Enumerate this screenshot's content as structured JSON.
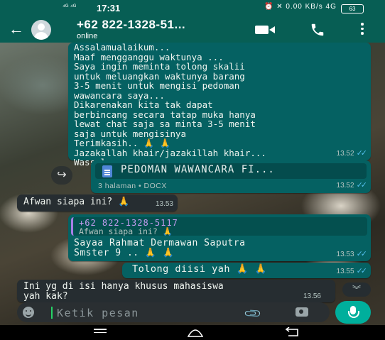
{
  "status_bar": {
    "signal": "⁴ᴳ ⁴ᴳ",
    "time": "17:31",
    "right_indicators": "⏰ ✕ 0.00 KB/s 4G",
    "battery": "63"
  },
  "header": {
    "back": "←",
    "contact_name": "+62 822-1328-51...",
    "status": "online"
  },
  "messages": [
    {
      "direction": "out",
      "text": "Assalamualaikum...\nMaaf mengganggu waktunya ...\nSaya ingin meminta tolong skalii\nuntuk meluangkan waktunya barang\n3-5 menit untuk mengisi pedoman\nwawancara saya...\nDikarenakan kita tak dapat\nberbincang secara tatap muka hanya\nlewat chat saja sa minta 3-5 menit\nsaja untuk mengisinya\nTerimkasih.. 🙏 🙏\nJazakallah khair/jazakillah khair...\nWassalam",
      "time": "13.52",
      "ticks": "✓✓"
    },
    {
      "direction": "out",
      "type": "document",
      "file_name": "PEDOMAN WAWANCARA FI...",
      "file_meta": "3 halaman • DOCX",
      "time": "13.52",
      "ticks": "✓✓"
    },
    {
      "direction": "in",
      "text": "Afwan siapa ini? 🙏",
      "time": "13.53"
    },
    {
      "direction": "out",
      "quote_name": "+62 822-1328-5117",
      "quote_text": "Afwan siapa ini? 🙏",
      "text": "Sayaa Rahmat Dermawan Saputra\nSmster 9 .. 🙏 🙏",
      "time": "13.53",
      "ticks": "✓✓"
    },
    {
      "direction": "out",
      "text": "Tolong diisi yah 🙏 🙏",
      "time": "13.55",
      "ticks": "✓✓"
    },
    {
      "direction": "in",
      "text": "Ini yg di isi hanya khusus mahasiswa\nyah kak?",
      "time": "13.56"
    }
  ],
  "input_bar": {
    "placeholder": "Ketik pesan"
  },
  "icons": {
    "forward": "↪",
    "scroll_down": "︾",
    "attach": "📎"
  },
  "colors": {
    "header": "#075e54",
    "outgoing_bubble": "#056162",
    "incoming_bubble": "#262d31",
    "read_ticks": "#53bdeb",
    "mic_button": "#00af9c"
  }
}
